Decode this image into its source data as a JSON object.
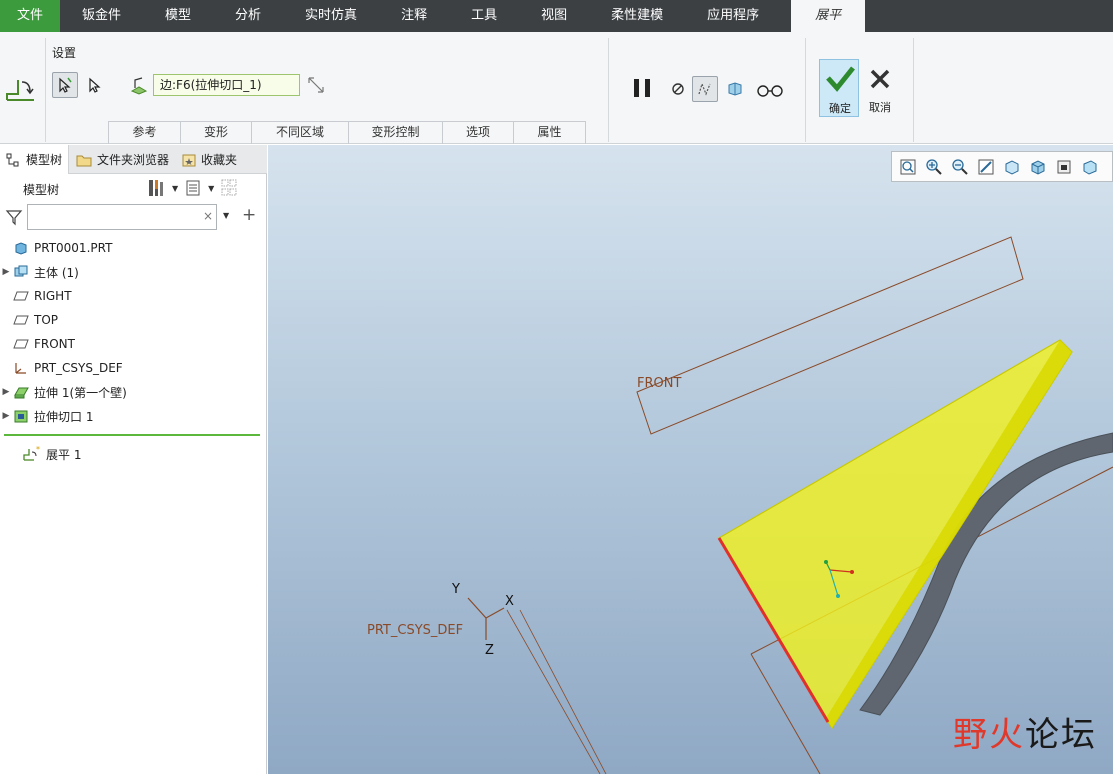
{
  "menu": {
    "tabs": [
      "文件",
      "钣金件",
      "模型",
      "分析",
      "实时仿真",
      "注释",
      "工具",
      "视图",
      "柔性建模",
      "应用程序",
      "展平"
    ]
  },
  "ribbon": {
    "settings_label": "设置",
    "edge_field_value": "边:F6(拉伸切口_1)",
    "subtabs": [
      "参考",
      "变形",
      "不同区域",
      "变形控制",
      "选项",
      "属性"
    ],
    "ok_label": "确定",
    "cancel_label": "取消"
  },
  "left_panel": {
    "tabs": [
      "模型树",
      "文件夹浏览器",
      "收藏夹"
    ],
    "tree_title": "模型树",
    "filter_placeholder": "",
    "tree_items": [
      {
        "label": "PRT0001.PRT",
        "icon": "part-icon",
        "expandable": false
      },
      {
        "label": "主体 (1)",
        "icon": "body-icon",
        "expandable": true
      },
      {
        "label": "RIGHT",
        "icon": "datum-plane-icon",
        "expandable": false
      },
      {
        "label": "TOP",
        "icon": "datum-plane-icon",
        "expandable": false
      },
      {
        "label": "FRONT",
        "icon": "datum-plane-icon",
        "expandable": false
      },
      {
        "label": "PRT_CSYS_DEF",
        "icon": "csys-icon",
        "expandable": false
      },
      {
        "label": "拉伸 1(第一个壁)",
        "icon": "extrude-wall-icon",
        "expandable": true
      },
      {
        "label": "拉伸切口 1",
        "icon": "extrude-cut-icon",
        "expandable": true
      },
      {
        "label": "展平 1",
        "icon": "flatten-icon",
        "expandable": false
      }
    ]
  },
  "viewport": {
    "front_label": "FRONT",
    "csys_label": "PRT_CSYS_DEF",
    "axis_x": "X",
    "axis_y": "Y",
    "axis_z": "Z",
    "watermark_a": "野火",
    "watermark_b": "论坛"
  },
  "colors": {
    "menubar": "#3c4043",
    "file_tab": "#3c9b3c",
    "accent_green": "#5cb83c",
    "highlight_yellow": "#f0f020",
    "edge_red": "#e0302a"
  }
}
